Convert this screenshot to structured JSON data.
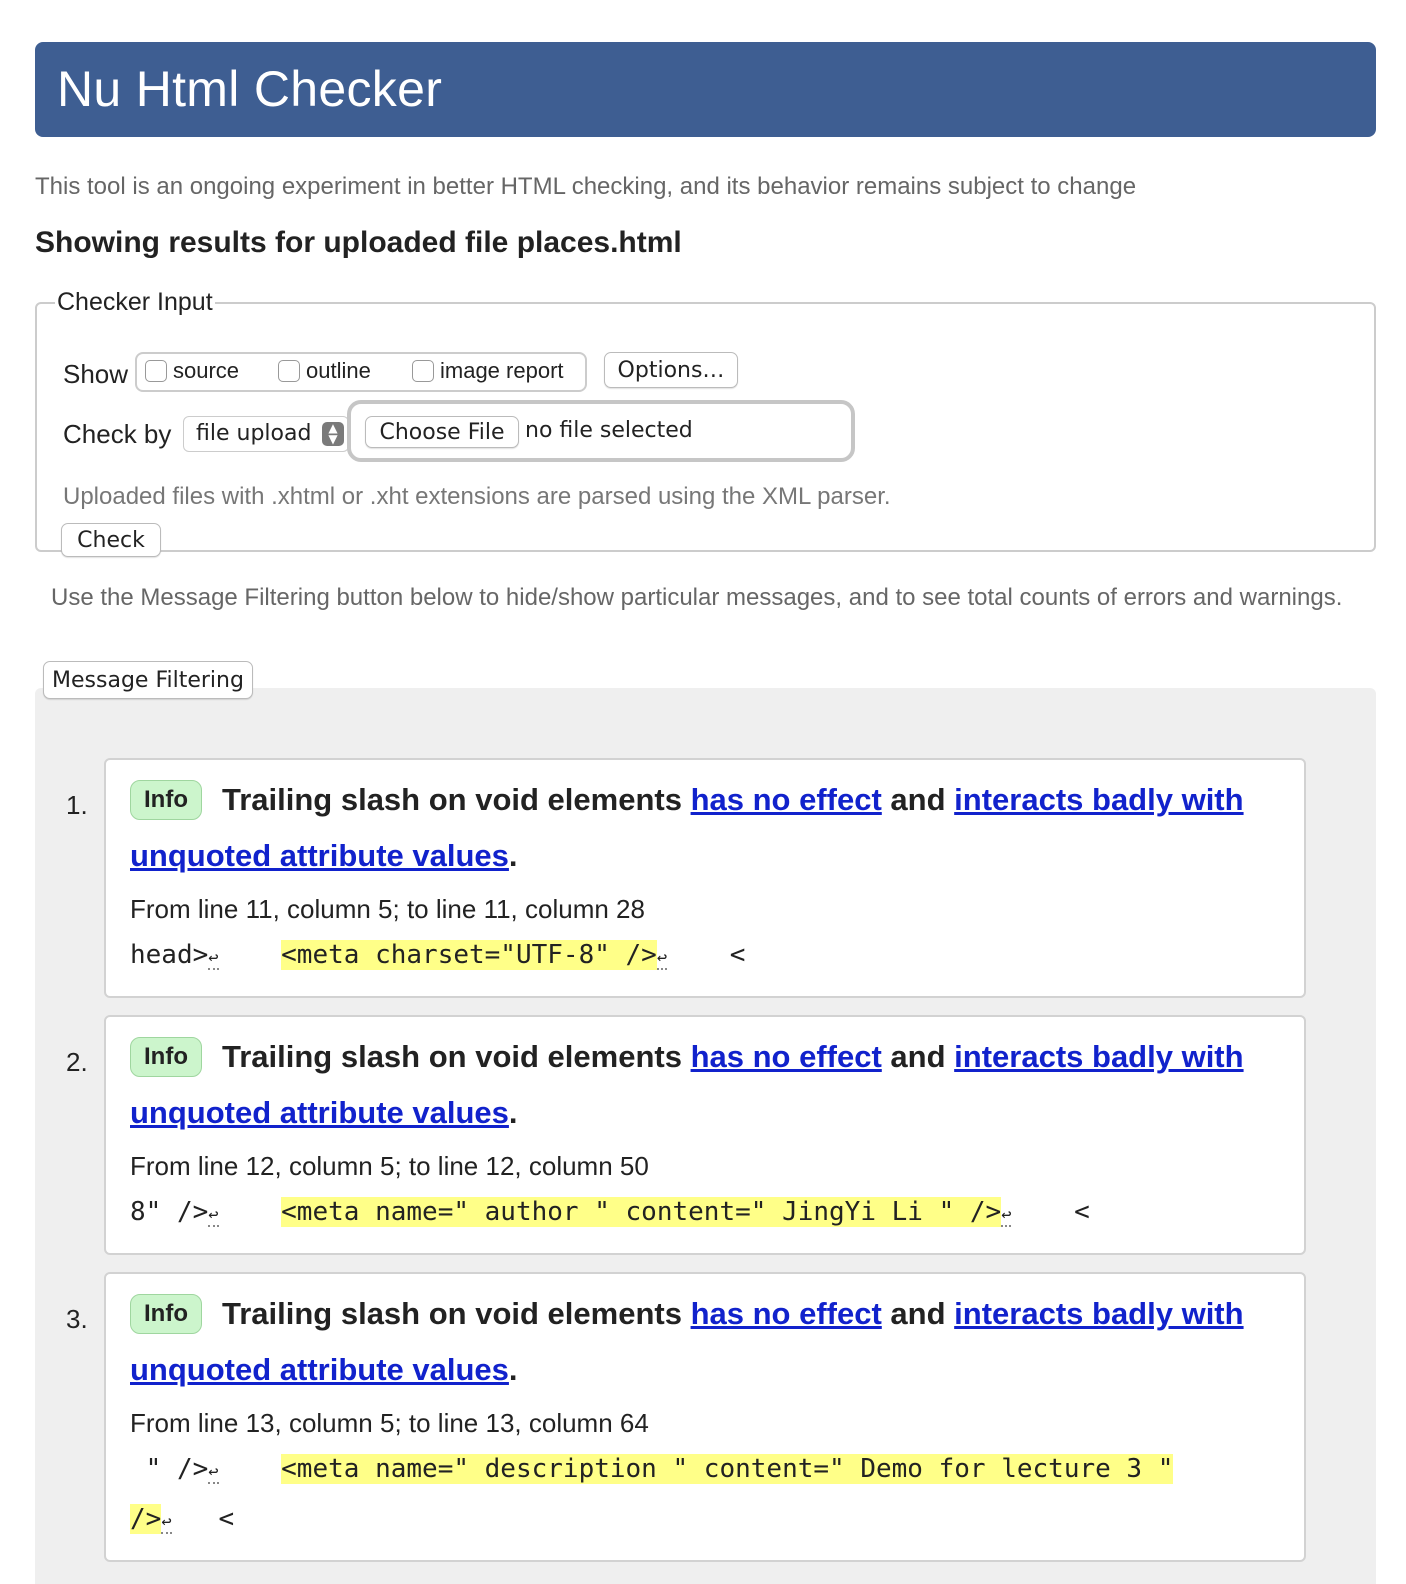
{
  "header": {
    "title": "Nu Html Checker"
  },
  "subtitle": "This tool is an ongoing experiment in better HTML checking, and its behavior remains subject to change",
  "results_title": "Showing results for uploaded file places.html",
  "checker_input": {
    "legend": "Checker Input",
    "show_label": "Show",
    "show_options": [
      "source",
      "outline",
      "image report"
    ],
    "options_button": "Options…",
    "check_by_label": "Check by",
    "check_by_value": "file upload",
    "choose_file_button": "Choose File",
    "file_status": "no file selected",
    "upload_note": "Uploaded files with .xhtml or .xht extensions are parsed using the XML parser.",
    "check_button": "Check"
  },
  "filter_note": "Use the Message Filtering button below to hide/show particular messages, and to see total counts of errors and warnings.",
  "message_filtering_button": "Message Filtering",
  "return_glyph": "↩",
  "messages": [
    {
      "number": "1.",
      "type": "Info",
      "text_start": "Trailing slash on void elements",
      "link1": "has no effect",
      "text_mid": "and",
      "link2_part1": "interacts badly with",
      "link2_part2": "unquoted attribute values",
      "text_end": ".",
      "location": "From line 11, column 5; to line 11, column 28",
      "extract_before": "head>",
      "extract_highlight": "<meta charset=\"UTF-8\" />",
      "extract_after": "<"
    },
    {
      "number": "2.",
      "type": "Info",
      "text_start": "Trailing slash on void elements",
      "link1": "has no effect",
      "text_mid": "and",
      "link2_part1": "interacts badly with",
      "link2_part2": "unquoted attribute values",
      "text_end": ".",
      "location": "From line 12, column 5; to line 12, column 50",
      "extract_before": "8\" />",
      "extract_highlight": "<meta name=\" author \" content=\" JingYi Li \" />",
      "extract_after": "<"
    },
    {
      "number": "3.",
      "type": "Info",
      "text_start": "Trailing slash on void elements",
      "link1": "has no effect",
      "text_mid": "and",
      "link2_part1": "interacts badly with",
      "link2_part2": "unquoted attribute values",
      "text_end": ".",
      "location": "From line 13, column 5; to line 13, column 64",
      "extract_before": " \" />",
      "extract_highlight": "<meta name=\" description \" content=\" Demo for lecture 3 \"",
      "extract_highlight_cont": "/>",
      "extract_after": "<"
    }
  ]
}
